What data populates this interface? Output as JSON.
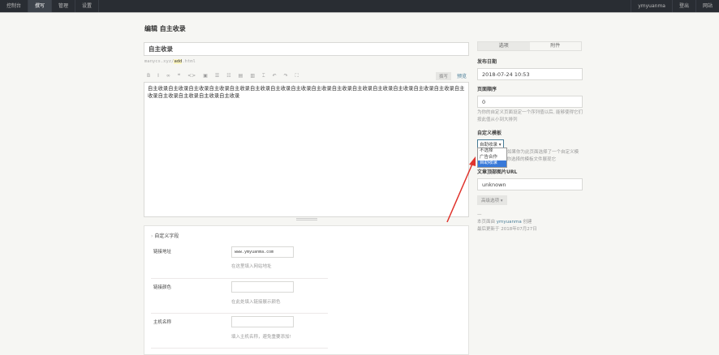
{
  "nav": {
    "left": [
      "控制台",
      "撰写",
      "管理",
      "设置"
    ],
    "active": 1,
    "right": [
      "ymyuanma",
      "登出",
      "网站"
    ]
  },
  "page_title": "编辑 自主收录",
  "title_value": "自主收录",
  "slug": {
    "prefix": "manycs.xyz/",
    "slug": "add",
    "suffix": ".html"
  },
  "toolbar": {
    "icons": [
      "B",
      "I",
      "∞",
      "❝",
      "<>",
      "▣",
      "☰",
      "☷",
      "▤",
      "▥",
      "⌶",
      "↶",
      "↷",
      "⛶"
    ],
    "write": "撰写",
    "preview": "预览"
  },
  "content": "自主收录自主收录自主收录自主收录自主收录自主收录自主收录自主收录自主收录自主收录自主收录自主收录自主收录自主收录自主收录自主收录自主收录自主收录自主收录自主收录",
  "custom_fields": {
    "title": "自定义字段",
    "fields": [
      {
        "name": "链接地址",
        "value": "www.ymyuanma.com",
        "hint": "在这里填入网站地址"
      },
      {
        "name": "链接颜色",
        "value": "",
        "hint": "在此处填入链接展示颜色"
      },
      {
        "name": "主机名称",
        "value": "",
        "hint": "填入主机名称，避免重要添加!"
      }
    ]
  },
  "sidebar": {
    "tabs": [
      "选项",
      "附件"
    ],
    "date_label": "发布日期",
    "date_value": "2018-07-24 10:53",
    "order_label": "页面顺序",
    "order_value": "0",
    "order_hint": "为你的自定义页面设定一个序列值以后, 能够使得它们按此值从小到大排列",
    "template_label": "自定义模板",
    "template_value": "自助收录",
    "template_options": [
      "不选择",
      "广告合作",
      "自助收录"
    ],
    "template_hint": "如果你为此页面选择了一个自定义模板, 系统将按照你选择的模板文件展现它",
    "img_label": "文章顶部图片URL",
    "img_value": "unknown",
    "advanced": "高级选项 ▾",
    "footer_pre": "本页面由 ",
    "author": "ymyuanma",
    "footer_post": " 创建",
    "updated": "最后更新于 2018年07月27日"
  },
  "colors": {
    "topbar": "#292d33",
    "link": "#467b96",
    "highlight": "#3879d9",
    "arrow": "#e0332c"
  }
}
